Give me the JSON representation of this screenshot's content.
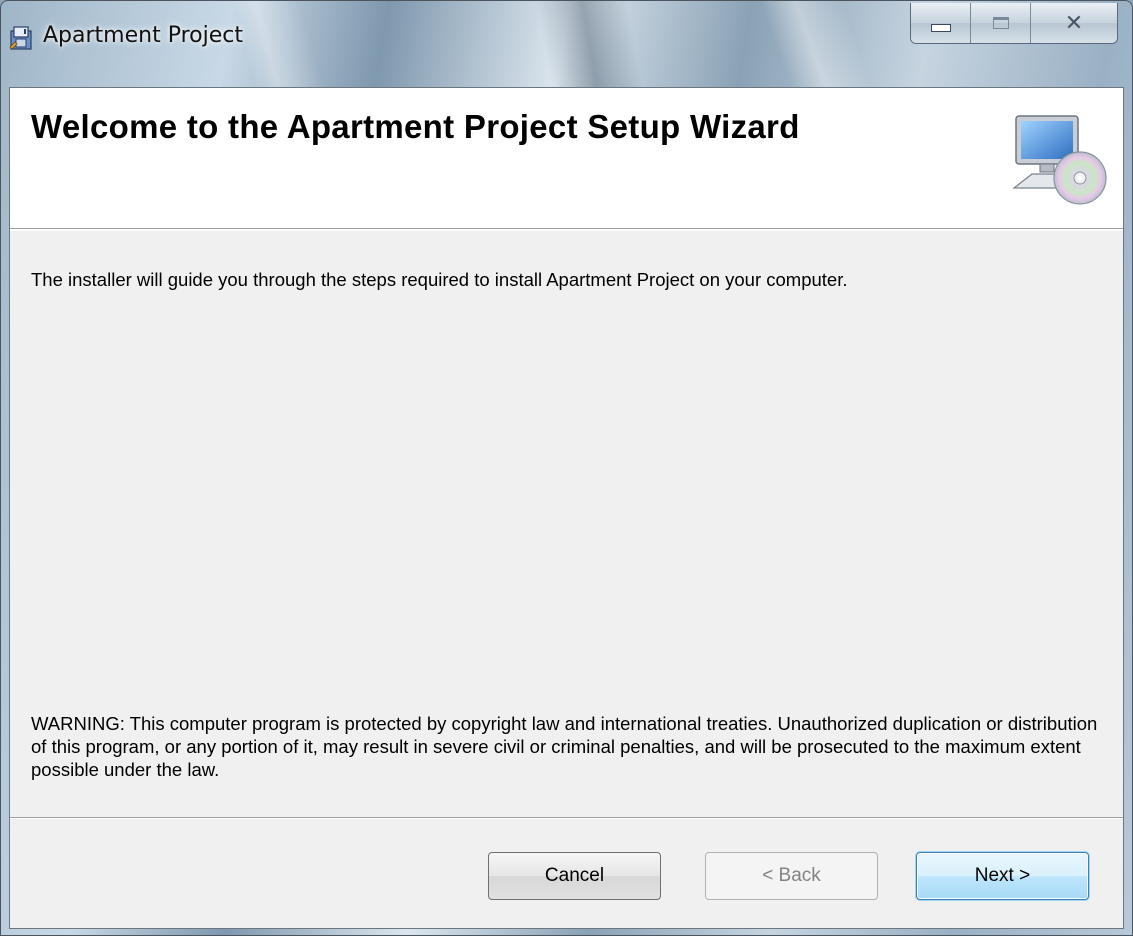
{
  "window": {
    "title": "Apartment Project",
    "close_glyph": "✕",
    "controls": [
      "minimize-icon",
      "maximize-icon",
      "close-icon"
    ]
  },
  "header": {
    "heading": "Welcome to the Apartment Project Setup Wizard",
    "icon": "computer-cd-icon"
  },
  "body": {
    "intro": "The installer will guide you through the steps required to install Apartment Project on your computer.",
    "warning": "WARNING: This computer program is protected by copyright law and international treaties. Unauthorized duplication or distribution of this program, or any portion of it, may result in severe civil or criminal penalties, and will be prosecuted to the maximum extent possible under the law."
  },
  "buttons": {
    "cancel": "Cancel",
    "back": "< Back",
    "next": "Next >"
  },
  "colors": {
    "dialog_background": "#f0f0f0",
    "header_background": "#ffffff",
    "default_button_border": "#3c7fb1",
    "disabled_text": "#838383"
  }
}
